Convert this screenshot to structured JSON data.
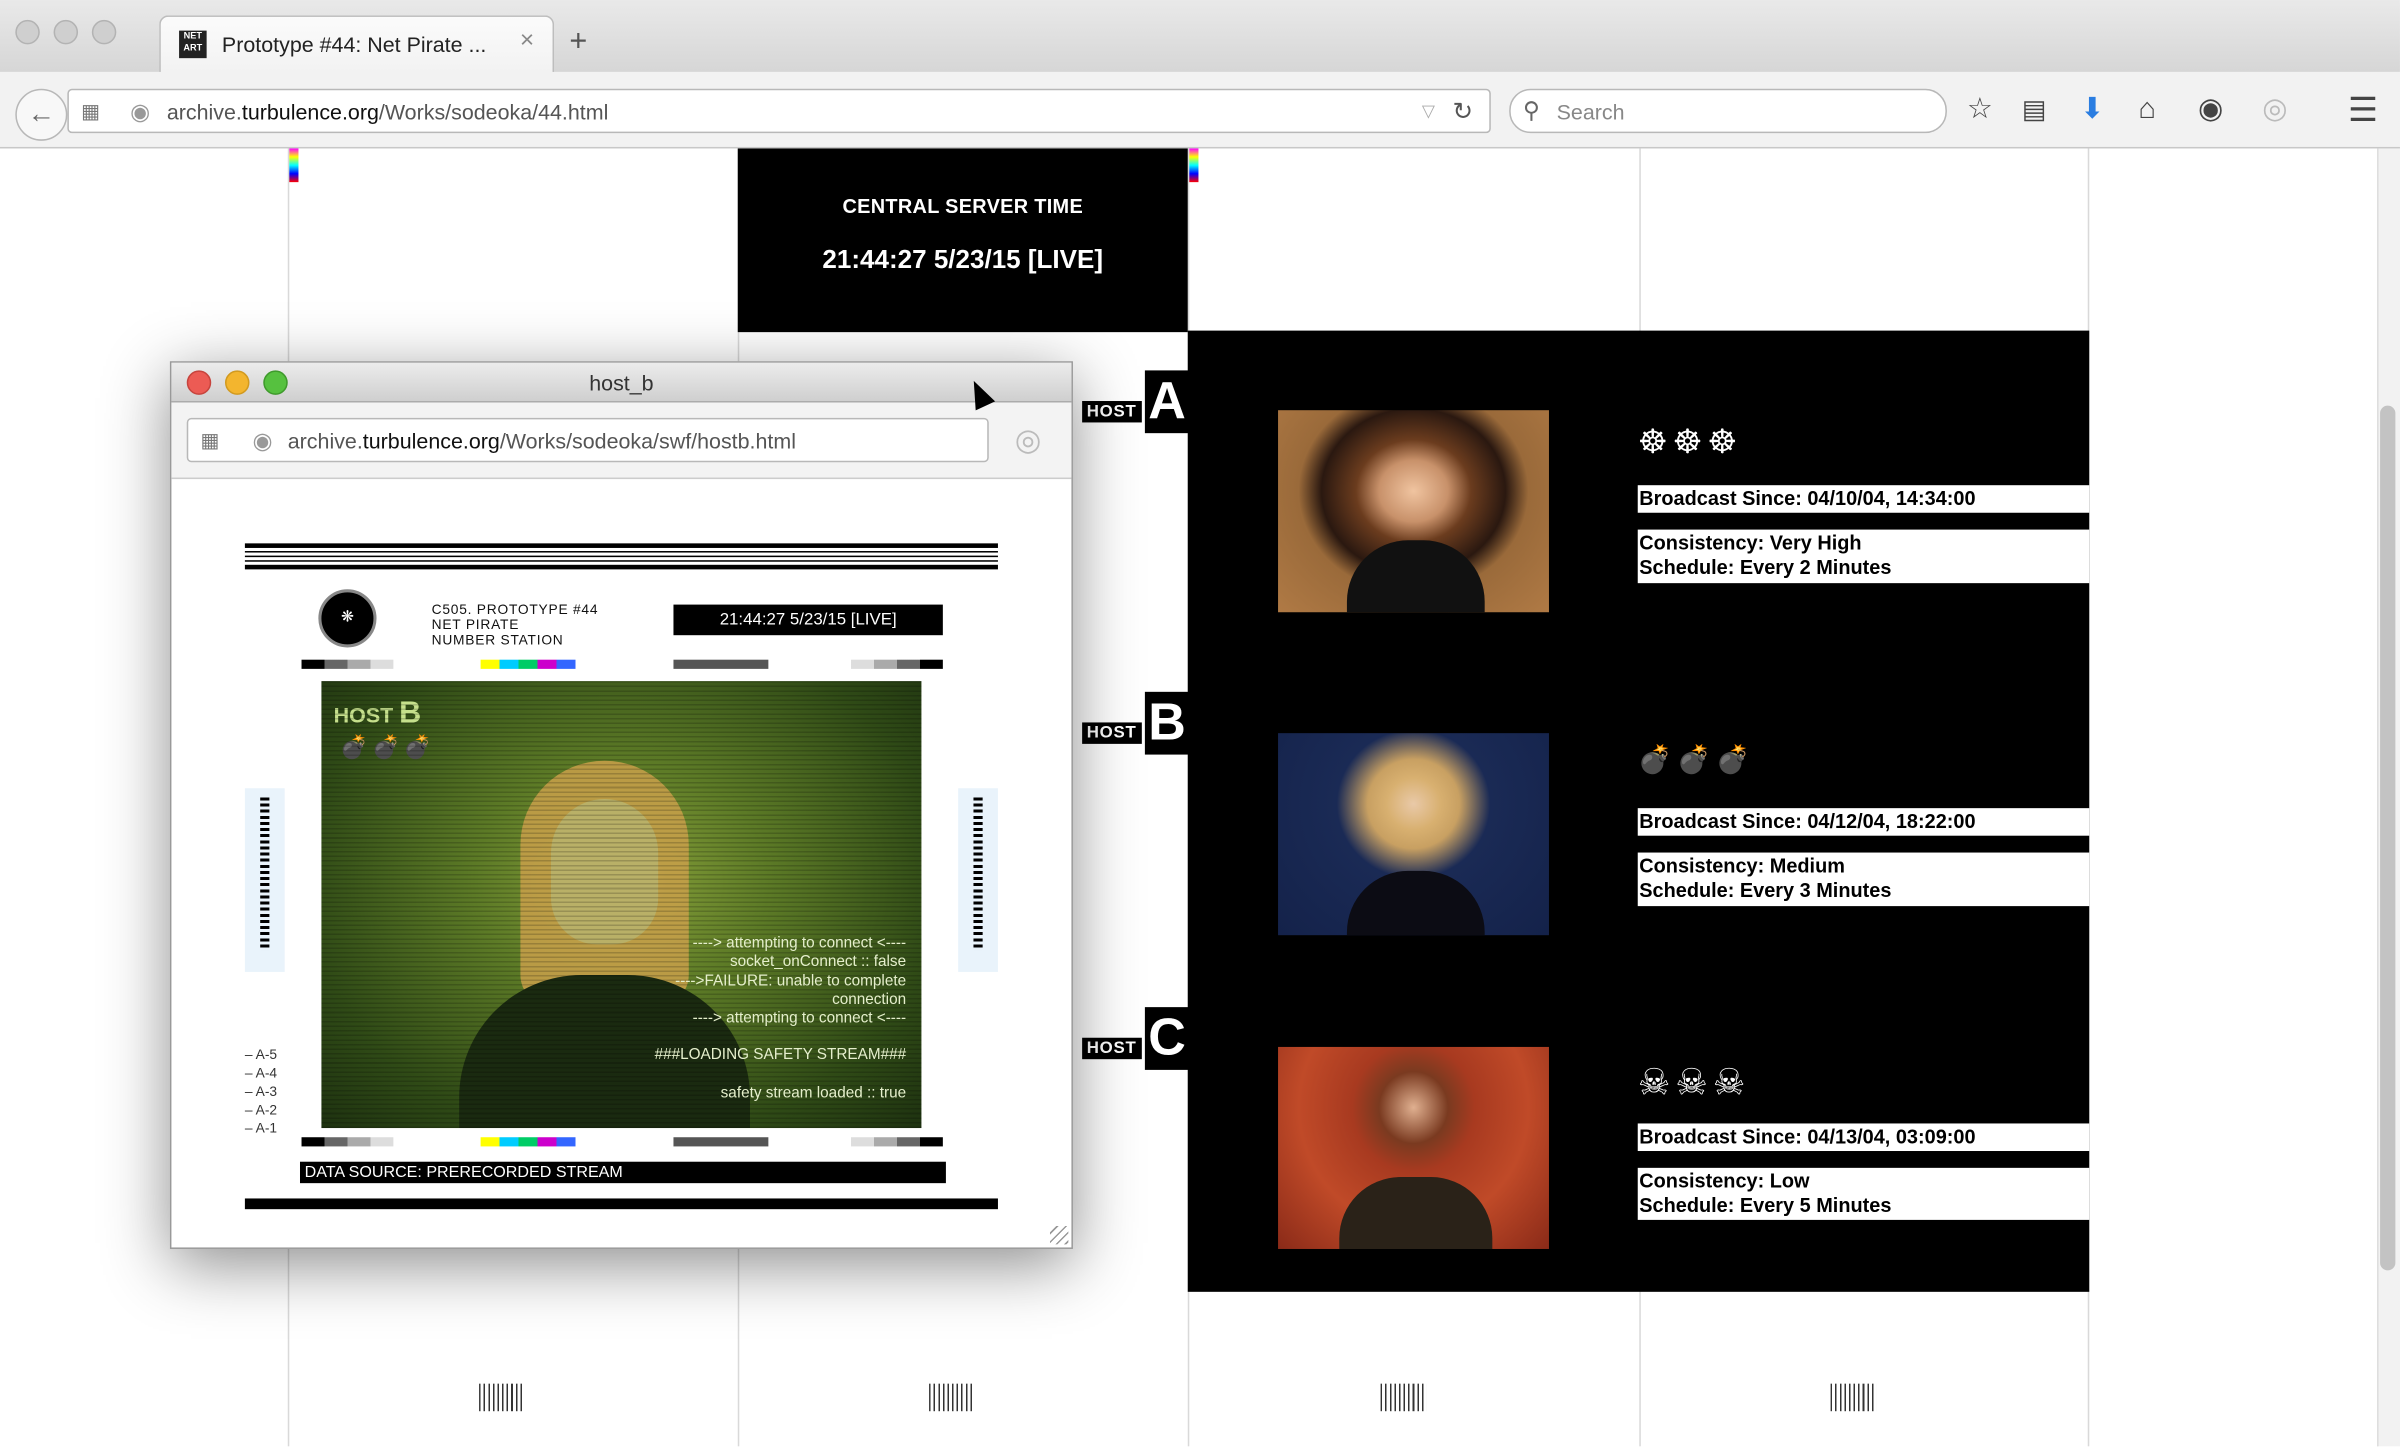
{
  "browser": {
    "tab_title": "Prototype #44: Net Pirate ...",
    "tab_close": "×",
    "new_tab": "+",
    "favicon_text": "NET ART",
    "url_prefix": "archive.",
    "url_domain": "turbulence.org",
    "url_path": "/Works/sodeoka/44.html",
    "search_placeholder": "Search",
    "icons": [
      "back-icon",
      "sidebar-icon",
      "globe-icon",
      "reader-icon",
      "reload-icon",
      "search-icon",
      "star-icon",
      "clipboard-icon",
      "download-icon",
      "home-icon",
      "chat-icon",
      "sync-icon",
      "menu-icon"
    ]
  },
  "server": {
    "label": "CENTRAL SERVER TIME",
    "time": "21:44:27 5/23/15 [LIVE]"
  },
  "hosts": [
    {
      "tag": "HOST",
      "letter": "A",
      "symbols": "☸☸☸",
      "broadcast": "Broadcast Since: 04/10/04, 14:34:00",
      "consistency": "Consistency: Very High",
      "schedule": "Schedule: Every 2 Minutes",
      "symbol_icon": "wheel-icon"
    },
    {
      "tag": "HOST",
      "letter": "B",
      "symbols": "💣💣💣",
      "broadcast": "Broadcast Since: 04/12/04, 18:22:00",
      "consistency": "Consistency: Medium",
      "schedule": "Schedule: Every 3 Minutes",
      "symbol_icon": "bomb-icon"
    },
    {
      "tag": "HOST",
      "letter": "C",
      "symbols": "☠☠☠",
      "broadcast": "Broadcast Since: 04/13/04, 03:09:00",
      "consistency": "Consistency: Low",
      "schedule": "Schedule: Every 5 Minutes",
      "symbol_icon": "skull-icon"
    }
  ],
  "popup": {
    "title": "host_b",
    "url_prefix": "archive.",
    "url_domain": "turbulence.org",
    "url_path": "/Works/sodeoka/swf/hostb.html",
    "station": {
      "line1": "C505. PROTOTYPE #44",
      "line2": "NET PIRATE",
      "line3": "NUMBER STATION",
      "clock": "21:44:27 5/23/15 [LIVE]",
      "video_host": "HOST",
      "video_letter": "B",
      "video_symbols": "💣💣💣",
      "log": [
        "---->  attempting to connect  <----",
        "socket_onConnect :: false",
        "---->FAILURE: unable to complete",
        "connection",
        "---->  attempting to connect  <----",
        "",
        "###LOADING SAFETY STREAM###",
        "",
        "safety stream loaded :: true"
      ],
      "data_source": "DATA SOURCE: PRERECORDED STREAM",
      "levels": [
        "A-5",
        "A-4",
        "A-3",
        "A-2",
        "A-1"
      ]
    }
  },
  "colors": {
    "page_bg": "#ffffff",
    "panel": "#000000",
    "video_tint": "#5c7a26"
  }
}
